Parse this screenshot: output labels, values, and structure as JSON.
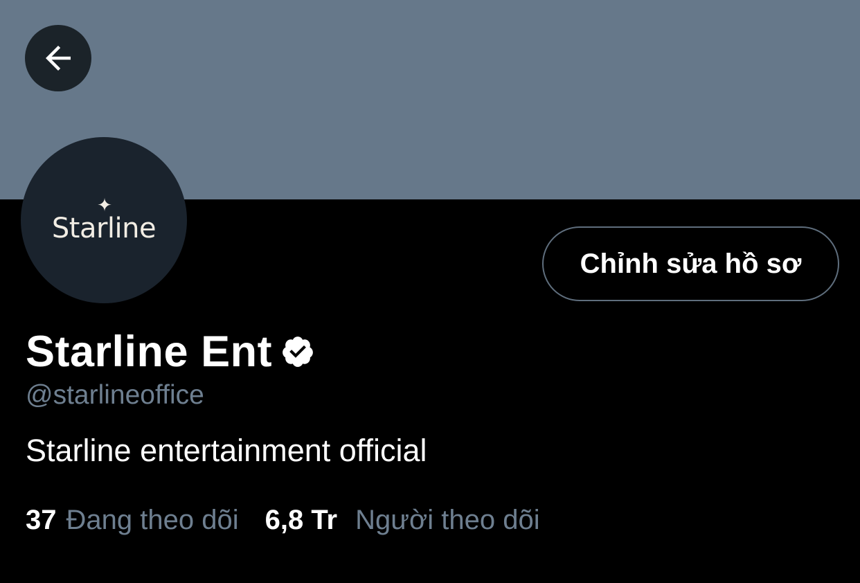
{
  "colors": {
    "banner": "#66788a",
    "background": "#000000",
    "back_button_bg": "#1b2329",
    "avatar_bg": "#1a232d",
    "edit_button_border": "#5f6e7d",
    "secondary_text": "#6e7f90",
    "primary_text": "#ffffff"
  },
  "header": {
    "back_icon": "arrow-left-icon"
  },
  "avatar": {
    "star_glyph": "✦",
    "wordmark": "Starline"
  },
  "actions": {
    "edit_profile_label": "Chỉnh sửa hồ sơ"
  },
  "profile": {
    "display_name": "Starline Ent",
    "verified_icon": "verified-badge-icon",
    "handle": "@starlineoffice",
    "bio": "Starline entertainment official"
  },
  "stats": {
    "following_count": "37",
    "following_label": "Đang theo dõi",
    "followers_count": "6,8 Tr",
    "followers_label": "Người theo dõi"
  }
}
